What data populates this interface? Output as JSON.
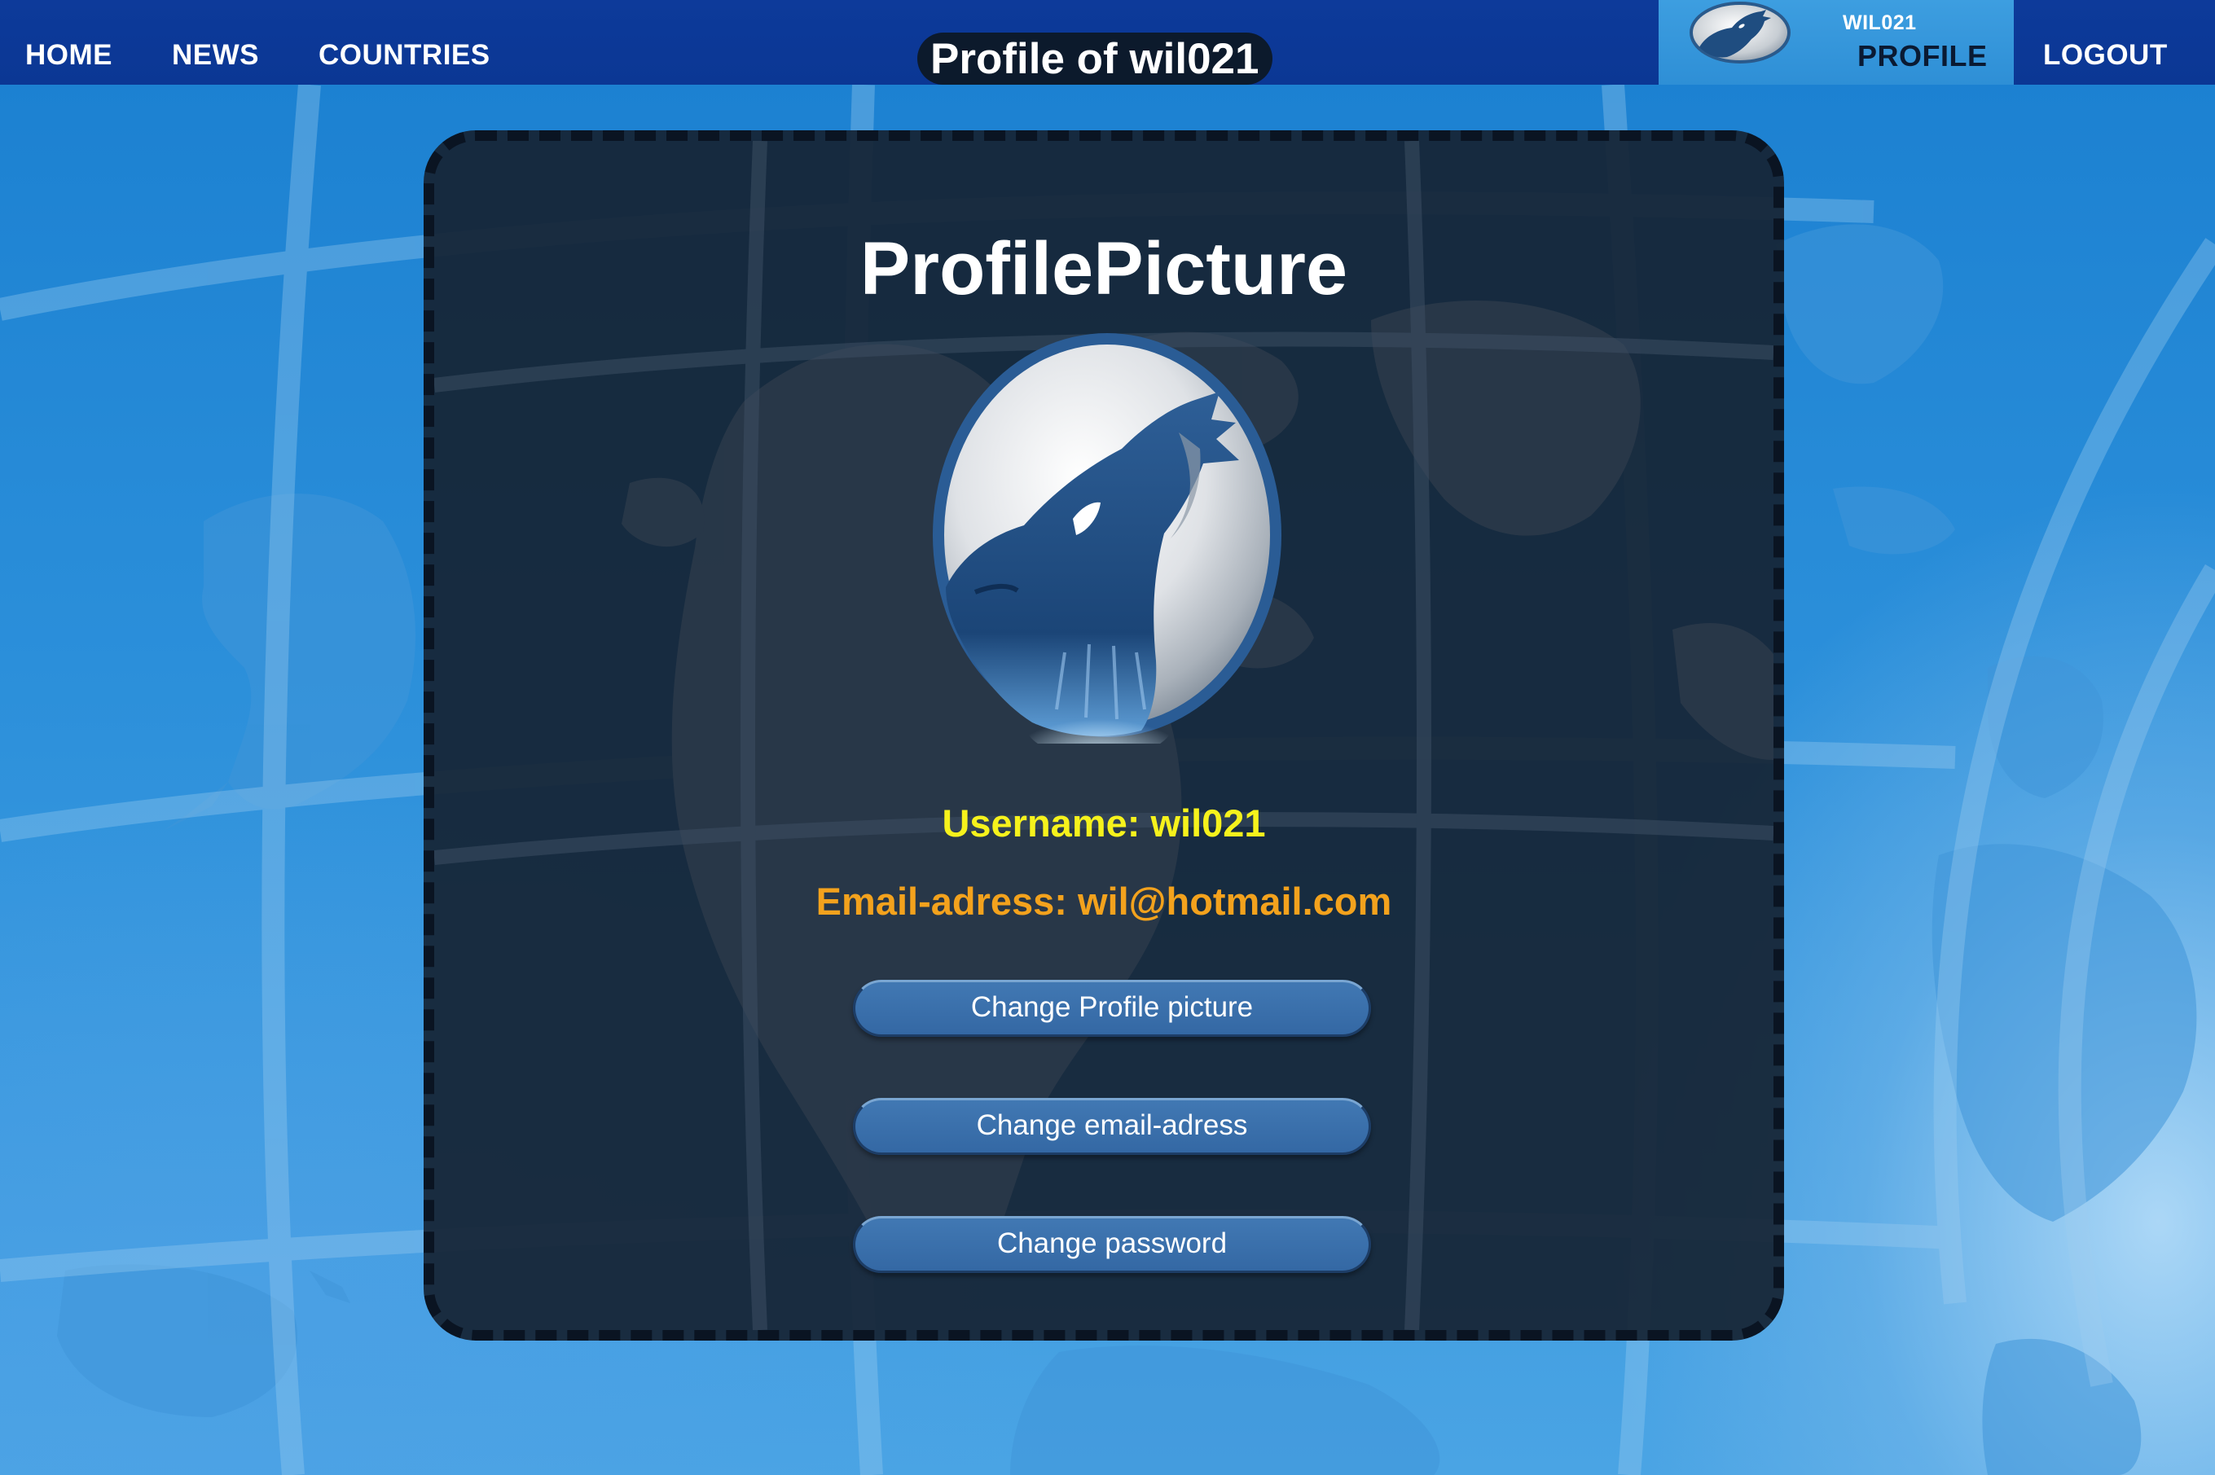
{
  "nav": {
    "home": "HOME",
    "news": "NEWS",
    "countries": "COUNTRIES",
    "logout": "LOGOUT"
  },
  "header": {
    "title": "Profile of wil021"
  },
  "profile_tab": {
    "username": "WIL021",
    "label": "PROFILE",
    "avatar_icon": "wolf-howling-icon"
  },
  "card": {
    "heading": "ProfilePicture",
    "avatar_icon": "wolf-howling-icon",
    "username_line": "Username: wil021",
    "email_line": "Email-adress: wil@hotmail.com",
    "buttons": {
      "change_picture": "Change Profile picture",
      "change_email": "Change email-adress",
      "change_password": "Change password"
    }
  },
  "colors": {
    "navbar": "#0b3794",
    "profile_tab": "#3598dc",
    "username_text": "#f6f21c",
    "email_text": "#f3a21d",
    "button": "#3a70ac",
    "card_background": "#162434"
  }
}
